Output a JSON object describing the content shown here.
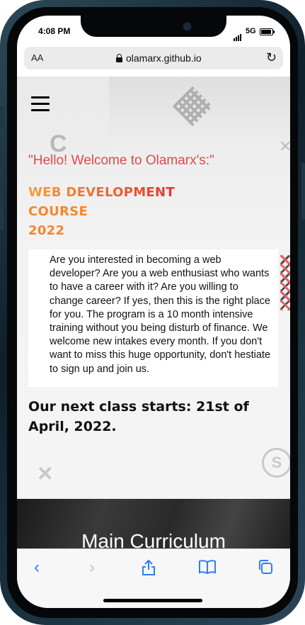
{
  "status_bar": {
    "time": "4:08 PM",
    "network": "5G"
  },
  "browser": {
    "text_size_label": "AA",
    "url": "olamarx.github.io",
    "icons": [
      "lock-icon",
      "reload-icon"
    ]
  },
  "page": {
    "welcome": "\"Hello! Welcome to Olamarx's:\"",
    "course_title_line1": "WEB DEVELOPMENT",
    "course_title_line2": "COURSE",
    "course_title_line3": "2022",
    "intro": "Are you interested in becoming a web developer? Are you a web enthusiast who wants to have a career with it? Are you willing to change career? If yes, then this is the right place for you. The program is a 10 month intensive training without you being disturb of finance. We welcome new intakes every month. If you don't want to miss this huge opportunity, don't hestiate to sign up and join us.",
    "next_class": "Our next class starts: 21st of April, 2022.",
    "section_heading": "Main Curriculum"
  },
  "toolbar": {
    "icons": [
      "back-icon",
      "forward-icon",
      "share-icon",
      "bookmarks-icon",
      "tabs-icon"
    ]
  },
  "colors": {
    "accent": "#2f7df6",
    "welcome_red": "#e5474c",
    "title_orange": "#f4872b"
  }
}
